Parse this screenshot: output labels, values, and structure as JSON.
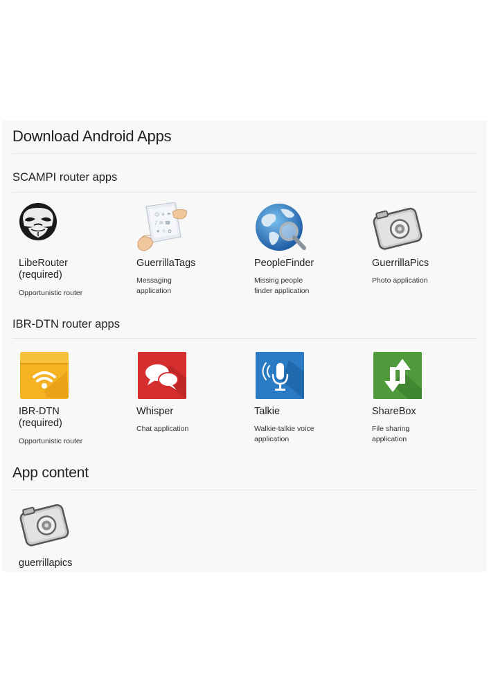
{
  "page_title": "Download Android Apps",
  "sections": [
    {
      "title": "SCAMPI router apps",
      "apps": [
        {
          "name": "LibeRouter",
          "note": "(required)",
          "desc": "Opportunistic router",
          "icon": "mask-icon"
        },
        {
          "name": "GuerrillaTags",
          "note": "",
          "desc": "Messaging application",
          "icon": "tags-icon"
        },
        {
          "name": "PeopleFinder",
          "note": "",
          "desc": "Missing people finder application",
          "icon": "globe-magnifier-icon"
        },
        {
          "name": "GuerrillaPics",
          "note": "",
          "desc": "Photo application",
          "icon": "camera-icon"
        }
      ]
    },
    {
      "title": "IBR-DTN router apps",
      "apps": [
        {
          "name": "IBR-DTN",
          "note": "(required)",
          "desc": "Opportunistic router",
          "icon": "wifi-box-icon"
        },
        {
          "name": "Whisper",
          "note": "",
          "desc": "Chat application",
          "icon": "chat-bubbles-icon"
        },
        {
          "name": "Talkie",
          "note": "",
          "desc": "Walkie-talkie voice application",
          "icon": "microphone-icon"
        },
        {
          "name": "ShareBox",
          "note": "",
          "desc": "File sharing application",
          "icon": "arrows-updown-icon"
        }
      ]
    }
  ],
  "content_section": {
    "title": "App content",
    "items": [
      {
        "name": "guerrillapics",
        "icon": "camera-icon"
      }
    ]
  },
  "colors": {
    "panel_bg": "#f8f8f8",
    "wifi_box": "#f5b324",
    "whisper": "#d42e2e",
    "talkie": "#2a7bc3",
    "sharebox": "#4f9a3a"
  }
}
